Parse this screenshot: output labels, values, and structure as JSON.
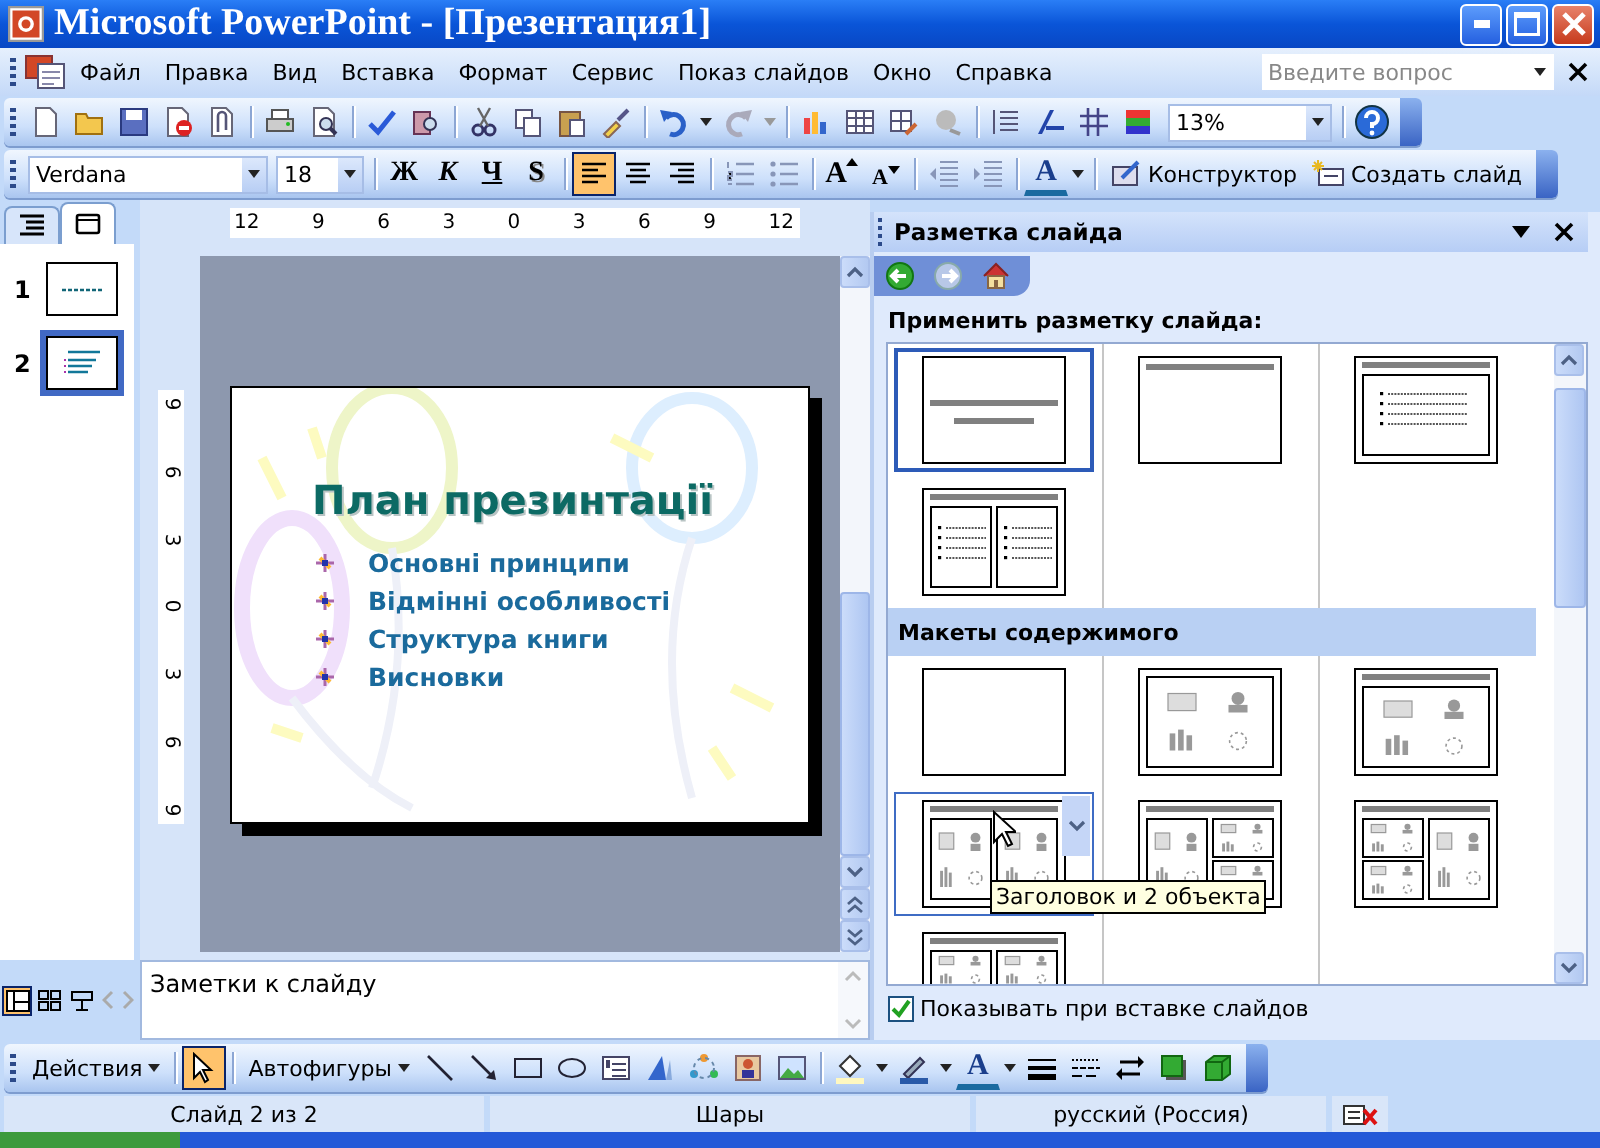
{
  "window": {
    "title": "Microsoft PowerPoint - [Презентация1]"
  },
  "menu": [
    "Файл",
    "Правка",
    "Вид",
    "Вставка",
    "Формат",
    "Сервис",
    "Показ слайдов",
    "Окно",
    "Справка"
  ],
  "help_search": {
    "placeholder": "Введите вопрос"
  },
  "standard_toolbar": {
    "zoom": "13%"
  },
  "formatting_toolbar": {
    "font": "Verdana",
    "size": "18",
    "style_buttons": [
      "Ж",
      "К",
      "Ч",
      "S"
    ],
    "alignment": [
      {
        "selected": true
      },
      {
        "selected": false
      },
      {
        "selected": false
      }
    ],
    "grow_font": "A",
    "shrink_font": "A",
    "font_color": "A",
    "buttons": [
      "Конструктор",
      "Создать слайд"
    ]
  },
  "pane_tabs": [
    {
      "selected": false
    },
    {
      "selected": true
    }
  ],
  "slides": [
    {
      "number": "1",
      "selected": false
    },
    {
      "number": "2",
      "selected": true
    }
  ],
  "ruler": {
    "horizontal": [
      "12",
      "9",
      "6",
      "3",
      "0",
      "3",
      "6",
      "9",
      "12"
    ],
    "vertical": [
      "9",
      "6",
      "3",
      "0",
      "3",
      "6",
      "9"
    ]
  },
  "slide": {
    "title": "План презинтації",
    "bullets": [
      "Основні принципи",
      "Відмінні особливості",
      "Структура книги",
      "Висновки"
    ]
  },
  "notes": {
    "placeholder": "Заметки к слайду"
  },
  "view_buttons": [
    {
      "selected": true
    },
    {
      "selected": false
    },
    {
      "selected": false
    }
  ],
  "task_pane": {
    "title": "Разметка слайда",
    "heading": "Применить разметку слайда:",
    "layouts": [
      {
        "kind": "title",
        "selected": true,
        "hovered": false
      },
      {
        "kind": "title-only",
        "selected": false,
        "hovered": false
      },
      {
        "kind": "title-text",
        "selected": false,
        "hovered": false
      },
      {
        "kind": "two-text",
        "selected": false,
        "hovered": false
      }
    ],
    "content_section": {
      "title": "Макеты содержимого",
      "layouts": [
        {
          "kind": "blank",
          "selected": false,
          "hovered": false
        },
        {
          "kind": "content",
          "selected": false,
          "hovered": false
        },
        {
          "kind": "title-content",
          "selected": false,
          "hovered": false
        },
        {
          "kind": "title-two-content",
          "selected": false,
          "hovered": true
        },
        {
          "kind": "title-content-two",
          "selected": false,
          "hovered": false
        },
        {
          "kind": "title-two-content-one",
          "selected": false,
          "hovered": false
        },
        {
          "kind": "title-four-content",
          "selected": false,
          "hovered": false
        }
      ]
    },
    "tooltip": "Заголовок и 2 объекта",
    "show_on_insert": {
      "label": "Показывать при вставке слайдов",
      "checked": true
    }
  },
  "drawing_toolbar": {
    "actions": "Действия",
    "autoshapes": "Автофигуры",
    "pointer_selected": true,
    "font_color": "A"
  },
  "status_bar": [
    "Слайд 2 из 2",
    "Шары",
    "русский (Россия)"
  ]
}
